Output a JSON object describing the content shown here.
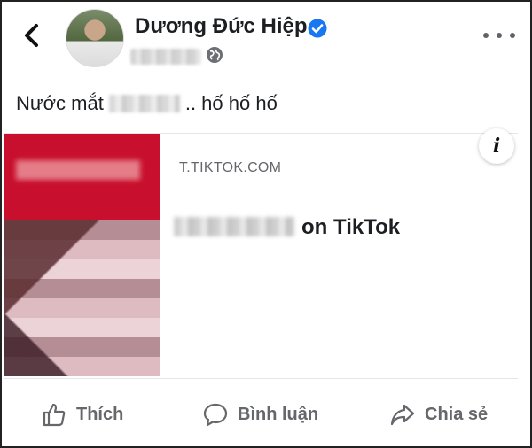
{
  "post": {
    "author_name": "Dương Đức Hiệp",
    "verified": true,
    "text_before": "Nước mắt",
    "text_after": ".. hố hố hố"
  },
  "link_preview": {
    "domain": "T.TIKTOK.COM",
    "title_suffix": "on TikTok",
    "info_label": "i"
  },
  "actions": {
    "like_label": "Thích",
    "comment_label": "Bình luận",
    "share_label": "Chia sẻ"
  },
  "colors": {
    "verified_blue": "#1877f2",
    "muted_text": "#65676b",
    "thumbnail_red": "#c8102e"
  },
  "icons": [
    "back-arrow-icon",
    "verified-badge-icon",
    "globe-icon",
    "more-options-icon",
    "info-icon",
    "like-icon",
    "comment-icon",
    "share-icon"
  ]
}
